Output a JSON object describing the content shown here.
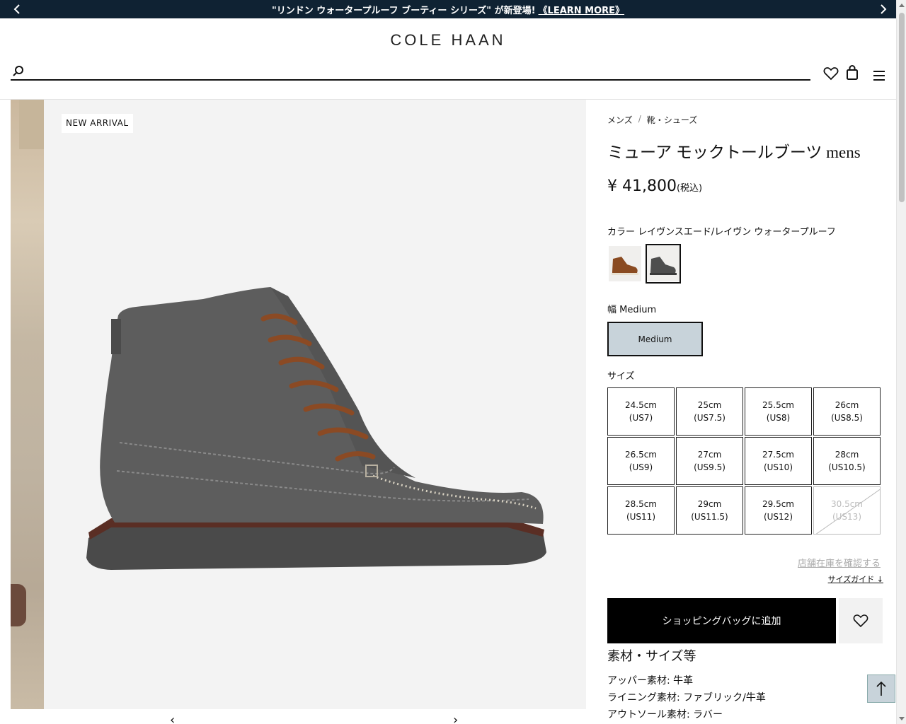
{
  "announcement": {
    "text": "\"リンドン ウォータープルーフ ブーティー シリーズ\" が新登場!",
    "link": "《LEARN MORE》"
  },
  "header": {
    "logo": "COLE HAAN",
    "search_placeholder": ""
  },
  "gallery": {
    "badge": "NEW ARRIVAL"
  },
  "breadcrumb": [
    "メンズ",
    "/",
    "靴・シューズ"
  ],
  "product": {
    "title": "ミューア モックトールブーツ mens",
    "price": "¥ 41,800",
    "tax_note": "(税込)"
  },
  "color": {
    "label": "カラー レイヴンスエード/レイヴン ウォータープルーフ",
    "swatches": [
      {
        "name": "brown",
        "color": "#8a4b22"
      },
      {
        "name": "grey",
        "color": "#4e4e4e",
        "selected": true
      }
    ]
  },
  "width": {
    "label": "幅 Medium",
    "option": "Medium"
  },
  "size": {
    "label": "サイズ",
    "options": [
      {
        "cm": "24.5cm",
        "us": "(US7)"
      },
      {
        "cm": "25cm",
        "us": "(US7.5)"
      },
      {
        "cm": "25.5cm",
        "us": "(US8)"
      },
      {
        "cm": "26cm",
        "us": "(US8.5)"
      },
      {
        "cm": "26.5cm",
        "us": "(US9)"
      },
      {
        "cm": "27cm",
        "us": "(US9.5)"
      },
      {
        "cm": "27.5cm",
        "us": "(US10)"
      },
      {
        "cm": "28cm",
        "us": "(US10.5)"
      },
      {
        "cm": "28.5cm",
        "us": "(US11)"
      },
      {
        "cm": "29cm",
        "us": "(US11.5)"
      },
      {
        "cm": "29.5cm",
        "us": "(US12)"
      },
      {
        "cm": "30.5cm",
        "us": "(US13)",
        "disabled": true
      }
    ]
  },
  "links": {
    "store_stock": "店舗在庫を確認する",
    "size_guide": "サイズガイド ↓"
  },
  "add_to_bag": "ショッピングバッグに追加",
  "materials": {
    "title": "素材・サイズ等",
    "lines": [
      "アッパー素材: 牛革",
      "ライニング素材: ファブリック/牛革",
      "アウトソール素材: ラバー"
    ]
  }
}
